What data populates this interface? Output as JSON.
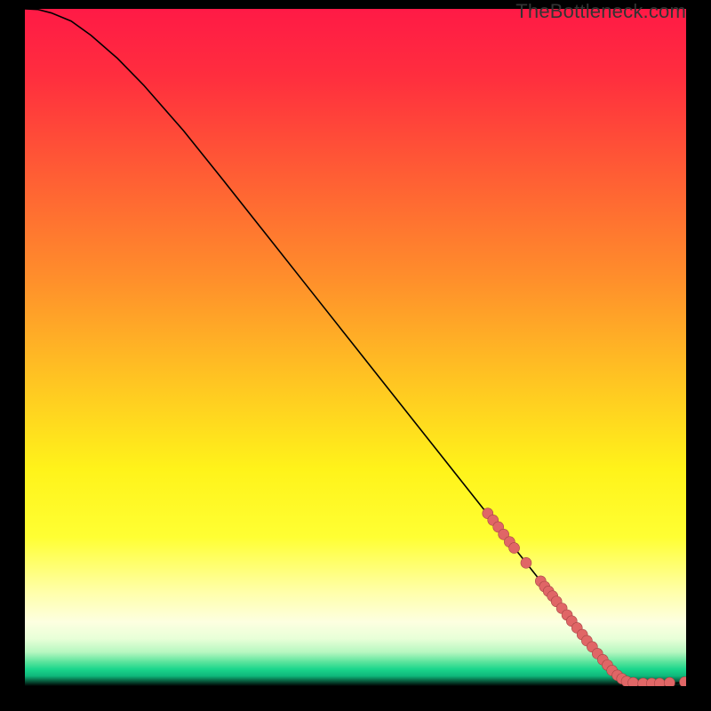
{
  "attribution": "TheBottleneck.com",
  "chart_data": {
    "type": "line",
    "title": "",
    "xlabel": "",
    "ylabel": "",
    "xlim": [
      0,
      100
    ],
    "ylim": [
      0,
      100
    ],
    "grid": false,
    "legend": false,
    "background_gradient": {
      "stops": [
        {
          "offset": 0.0,
          "color": "#ff1a46"
        },
        {
          "offset": 0.1,
          "color": "#ff2e3e"
        },
        {
          "offset": 0.25,
          "color": "#ff5f34"
        },
        {
          "offset": 0.4,
          "color": "#ff8f2b"
        },
        {
          "offset": 0.55,
          "color": "#ffc522"
        },
        {
          "offset": 0.68,
          "color": "#fff31a"
        },
        {
          "offset": 0.78,
          "color": "#ffff33"
        },
        {
          "offset": 0.86,
          "color": "#ffffa8"
        },
        {
          "offset": 0.905,
          "color": "#fdffe0"
        },
        {
          "offset": 0.93,
          "color": "#e8ffd8"
        },
        {
          "offset": 0.95,
          "color": "#b6f7c0"
        },
        {
          "offset": 0.965,
          "color": "#56e39b"
        },
        {
          "offset": 0.975,
          "color": "#1bd68c"
        },
        {
          "offset": 0.985,
          "color": "#0fb87b"
        },
        {
          "offset": 1.0,
          "color": "#000000"
        }
      ]
    },
    "curve": {
      "x": [
        0,
        2,
        4,
        7,
        10,
        14,
        18,
        24,
        30,
        36,
        42,
        48,
        54,
        60,
        66,
        72,
        78,
        82,
        86,
        88,
        90,
        92,
        94,
        96,
        98,
        100
      ],
      "y": [
        100.0,
        99.9,
        99.4,
        98.2,
        96.1,
        92.7,
        88.7,
        82.0,
        74.7,
        67.3,
        59.9,
        52.5,
        45.1,
        37.7,
        30.3,
        22.9,
        15.5,
        10.5,
        5.5,
        3.2,
        1.5,
        0.6,
        0.3,
        0.3,
        0.4,
        0.6
      ]
    },
    "points": {
      "radius": 6,
      "fill": "#e06666",
      "stroke": "#a64545",
      "data": [
        {
          "x": 70.0,
          "y": 25.5
        },
        {
          "x": 70.8,
          "y": 24.5
        },
        {
          "x": 71.6,
          "y": 23.5
        },
        {
          "x": 72.4,
          "y": 22.4
        },
        {
          "x": 73.3,
          "y": 21.3
        },
        {
          "x": 74.0,
          "y": 20.4
        },
        {
          "x": 75.8,
          "y": 18.2
        },
        {
          "x": 78.0,
          "y": 15.5
        },
        {
          "x": 78.6,
          "y": 14.7
        },
        {
          "x": 79.2,
          "y": 14.0
        },
        {
          "x": 79.8,
          "y": 13.3
        },
        {
          "x": 80.4,
          "y": 12.5
        },
        {
          "x": 81.2,
          "y": 11.5
        },
        {
          "x": 82.0,
          "y": 10.5
        },
        {
          "x": 82.7,
          "y": 9.6
        },
        {
          "x": 83.5,
          "y": 8.6
        },
        {
          "x": 84.3,
          "y": 7.6
        },
        {
          "x": 85.0,
          "y": 6.7
        },
        {
          "x": 85.8,
          "y": 5.8
        },
        {
          "x": 86.6,
          "y": 4.8
        },
        {
          "x": 87.4,
          "y": 3.9
        },
        {
          "x": 88.1,
          "y": 3.1
        },
        {
          "x": 88.8,
          "y": 2.3
        },
        {
          "x": 89.6,
          "y": 1.6
        },
        {
          "x": 90.3,
          "y": 1.1
        },
        {
          "x": 91.0,
          "y": 0.7
        },
        {
          "x": 92.0,
          "y": 0.5
        },
        {
          "x": 93.5,
          "y": 0.4
        },
        {
          "x": 94.8,
          "y": 0.4
        },
        {
          "x": 96.0,
          "y": 0.4
        },
        {
          "x": 97.5,
          "y": 0.5
        },
        {
          "x": 99.8,
          "y": 0.6
        }
      ]
    }
  }
}
